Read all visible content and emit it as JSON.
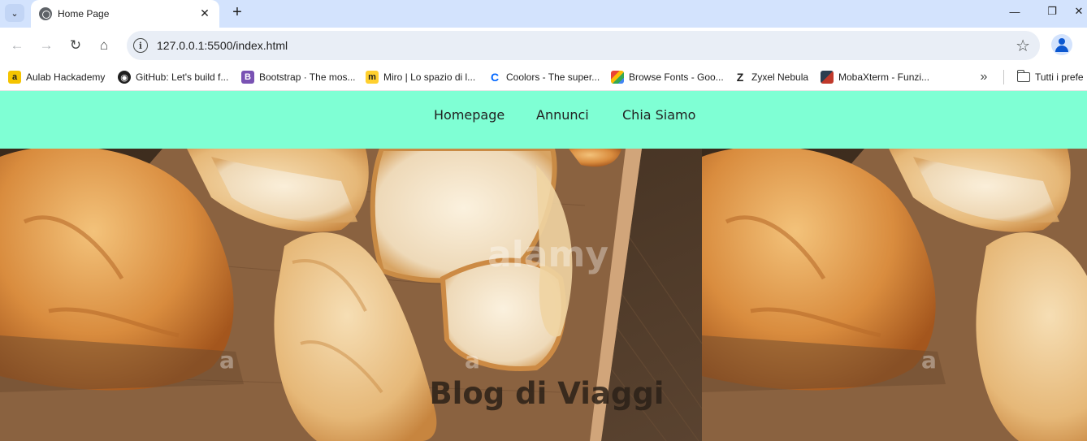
{
  "browser": {
    "tab_title": "Home Page",
    "url": "127.0.0.1:5500/index.html",
    "bookmarks": [
      {
        "label": "Aulab Hackademy",
        "icon": "aulab-icon",
        "color": "#f5c400"
      },
      {
        "label": "GitHub: Let's build f...",
        "icon": "github-icon",
        "color": "#1f1f1f"
      },
      {
        "label": "Bootstrap · The mos...",
        "icon": "bootstrap-icon",
        "color": "#7952b3"
      },
      {
        "label": "Miro | Lo spazio di l...",
        "icon": "miro-icon",
        "color": "#ffd02f"
      },
      {
        "label": "Coolors - The super...",
        "icon": "coolors-icon",
        "color": "#0066ff"
      },
      {
        "label": "Browse Fonts - Goo...",
        "icon": "google-fonts-icon",
        "color": "#4285f4"
      },
      {
        "label": "Zyxel Nebula",
        "icon": "zyxel-icon",
        "color": "#1f1f1f"
      },
      {
        "label": "MobaXterm - Funzi...",
        "icon": "mobaxterm-icon",
        "color": "#c0392b"
      }
    ],
    "other_bookmarks": "Tutti i prefe"
  },
  "site": {
    "nav": [
      "Homepage",
      "Annunci",
      "Chia Siamo"
    ],
    "hero_title": "Blog di Viaggi",
    "nav_color": "#7fffd4"
  }
}
